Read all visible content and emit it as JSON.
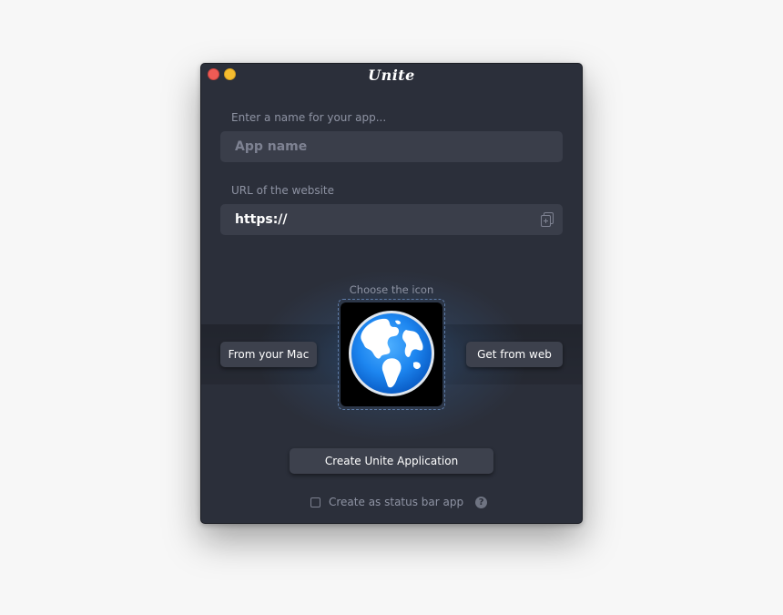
{
  "window": {
    "title": "Unite",
    "traffic_colors": {
      "close": "#ee5b55",
      "minimize": "#f5bc2f"
    }
  },
  "form": {
    "name_label": "Enter a name for your app...",
    "name_placeholder": "App name",
    "name_value": "",
    "url_label": "URL of the website",
    "url_value": "https://",
    "url_icon": "paste-icon"
  },
  "icon_picker": {
    "label": "Choose the icon",
    "icon": "globe-icon",
    "from_mac_label": "From your Mac",
    "from_web_label": "Get from web"
  },
  "actions": {
    "create_label": "Create Unite Application",
    "status_bar_label": "Create as status bar app",
    "status_bar_checked": false,
    "help_label": "?"
  },
  "colors": {
    "window_bg": "#2b2f3a",
    "field_bg": "#3a3e4a",
    "button_bg": "#3d414d",
    "accent_glow": "#3c82d2"
  }
}
